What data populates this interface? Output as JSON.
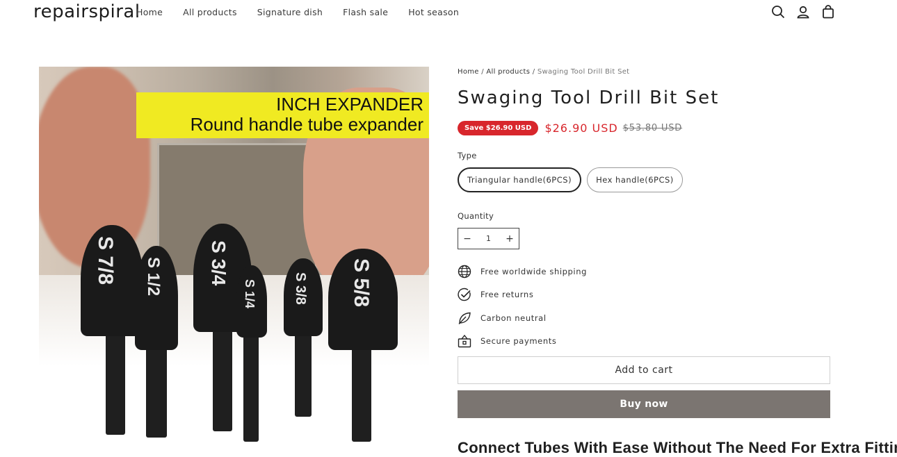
{
  "header": {
    "logo": "repairspiral",
    "nav": [
      "Home",
      "All products",
      "Signature dish",
      "Flash sale",
      "Hot season"
    ],
    "icons": [
      "search-icon",
      "account-icon",
      "cart-icon"
    ]
  },
  "image": {
    "banner_line1": "INCH EXPANDER",
    "banner_line2": "Round handle tube expander",
    "bit_labels": [
      "S 7/8",
      "S 1/2",
      "S 3/4",
      "S 1/4",
      "S 3/8",
      "S 5/8"
    ]
  },
  "breadcrumb": {
    "home": "Home",
    "sep": " / ",
    "category": "All products",
    "current": "Swaging Tool Drill Bit Set"
  },
  "product": {
    "title": "Swaging Tool Drill Bit Set",
    "save_badge": "Save $26.90 USD",
    "sale_price": "$26.90 USD",
    "original_price": "$53.80 USD",
    "type_label": "Type",
    "variants": [
      "Triangular handle(6PCS)",
      "Hex handle(6PCS)"
    ],
    "selected_variant": "Triangular handle(6PCS)",
    "quantity_label": "Quantity",
    "quantity_value": "1",
    "quantity_minus": "−",
    "quantity_plus": "+"
  },
  "features": [
    {
      "icon": "globe-icon",
      "text": "Free worldwide shipping"
    },
    {
      "icon": "check-circle-icon",
      "text": "Free returns"
    },
    {
      "icon": "leaf-icon",
      "text": "Carbon neutral"
    },
    {
      "icon": "lock-box-icon",
      "text": "Secure payments"
    }
  ],
  "actions": {
    "add_to_cart": "Add to cart",
    "buy_now": "Buy now"
  },
  "description": {
    "heading": "Connect Tubes With Ease Without The Need For Extra Fittings!"
  },
  "colors": {
    "accent_red": "#d8262c",
    "buy_button": "#7b7571",
    "banner_yellow": "#f0ea22"
  }
}
